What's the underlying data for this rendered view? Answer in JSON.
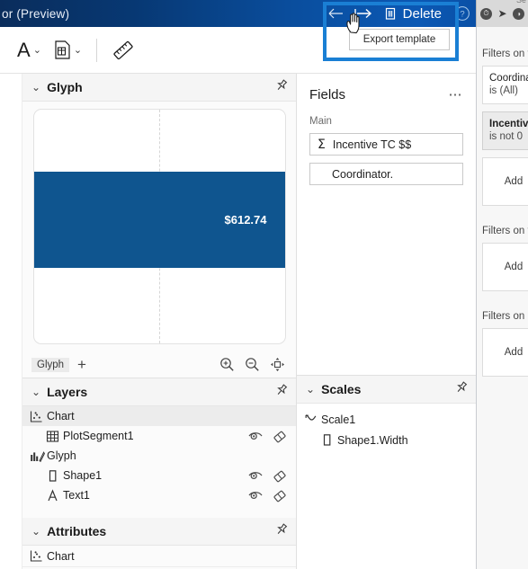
{
  "titlebar": {
    "title": "or (Preview)",
    "back_icon": "arrow-left-icon",
    "export_icon": "export-template-icon",
    "delete_icon": "trash-icon",
    "delete_label": "Delete",
    "help_icon": "help-circle-icon",
    "tooltip": "Export template",
    "gradient_from": "#0a2d5c",
    "gradient_to": "#0b58b4",
    "highlight_color": "#1a7fd4"
  },
  "toolbar": {
    "items": [
      {
        "name": "text-tool",
        "icon": "letter-a-icon",
        "chevron": "⌄"
      },
      {
        "name": "symbol-tool",
        "icon": "image-symbol-icon",
        "chevron": "⌄"
      },
      {
        "name": "scale-tool",
        "icon": "ruler-icon"
      }
    ]
  },
  "glyph_panel": {
    "chevron": "⌄",
    "title": "Glyph",
    "pin_icon": "pin-icon",
    "bar_label": "$612.74",
    "bar_color": "#0f558f",
    "bottom": {
      "tab_label": "Glyph",
      "add_label": "+",
      "zoom_in_icon": "zoom-in-icon",
      "zoom_out_icon": "zoom-out-icon",
      "fit_icon": "fit-to-screen-icon"
    }
  },
  "layers_panel": {
    "chevron": "⌄",
    "title": "Layers",
    "pin_icon": "pin-icon",
    "rows": [
      {
        "label": "Chart",
        "icon": "scatter-chart-icon",
        "indent": false,
        "selected": true,
        "actions": false
      },
      {
        "label": "PlotSegment1",
        "icon": "grid-icon",
        "indent": true,
        "selected": false,
        "actions": true
      },
      {
        "label": "Glyph",
        "icon": "glyph-icon",
        "indent": false,
        "selected": false,
        "actions": false
      },
      {
        "label": "Shape1",
        "icon": "rectangle-icon",
        "indent": true,
        "selected": false,
        "actions": true
      },
      {
        "label": "Text1",
        "icon": "letter-a-icon",
        "indent": true,
        "selected": false,
        "actions": true
      }
    ],
    "visibility_icon": "eye-icon",
    "clear_icon": "eraser-icon"
  },
  "attributes_panel": {
    "chevron": "⌄",
    "title": "Attributes",
    "pin_icon": "pin-icon",
    "rows": [
      {
        "label": "Chart",
        "icon": "scatter-chart-icon"
      }
    ]
  },
  "fields_panel": {
    "title": "Fields",
    "menu_icon": "more-options-icon",
    "subtitle": "Main",
    "items": [
      {
        "label": "Incentive TC $$",
        "icon": "sigma-icon",
        "has_icon": true
      },
      {
        "label": "Coordinator.",
        "icon": "",
        "has_icon": false
      }
    ]
  },
  "scales_panel": {
    "chevron": "⌄",
    "title": "Scales",
    "pin_icon": "pin-icon",
    "rows": [
      {
        "label": "Scale1",
        "icon": "scale-icon",
        "indent": false
      },
      {
        "label": "Shape1.Width",
        "icon": "rectangle-icon",
        "indent": true
      }
    ]
  },
  "filters_pane": {
    "sections": [
      {
        "title": "Filters on t",
        "cards": [
          {
            "name": "Coordina",
            "condition": "is (All)",
            "active": false
          },
          {
            "name": "Incentive",
            "condition": "is not 0",
            "active": true
          }
        ],
        "add_label": "Add"
      },
      {
        "title": "Filters on t",
        "cards": [],
        "add_label": "Add"
      },
      {
        "title": "Filters on a",
        "cards": [],
        "add_label": "Add"
      }
    ]
  },
  "os_strip": {
    "chips": [
      "◔",
      "➤",
      "◑"
    ],
    "ghost_label": "Se"
  }
}
